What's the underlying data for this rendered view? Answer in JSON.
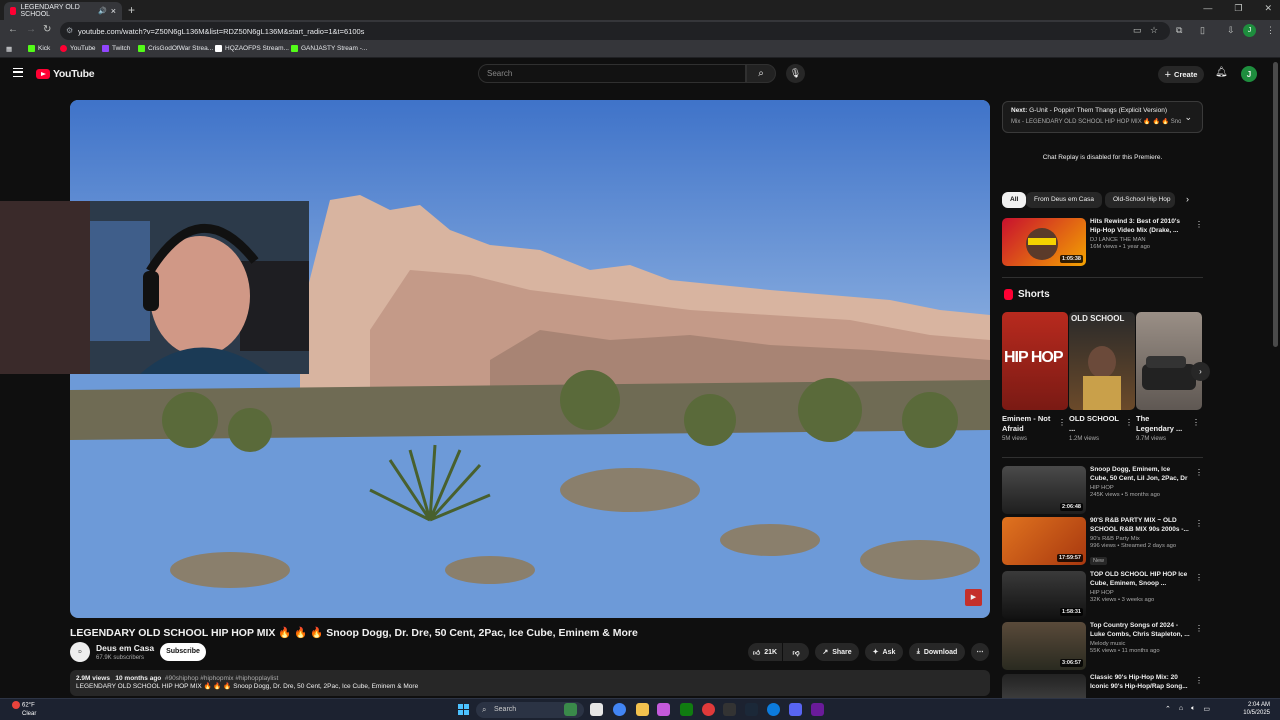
{
  "browser": {
    "tab_title": "LEGENDARY OLD SCHOOL",
    "tab_close": "×",
    "new_tab": "+",
    "url": "youtube.com/watch?v=Z50N6gL136M&list=RDZ50N6gL136M&start_radio=1&t=6100s",
    "bookmarks": [
      {
        "label": "Kick",
        "color": "#53fc18"
      },
      {
        "label": "YouTube",
        "color": "#ff0033"
      },
      {
        "label": "Twitch",
        "color": "#9146ff"
      },
      {
        "label": "CrisGodOfWar Strea...",
        "color": "#53fc18"
      },
      {
        "label": "HQZAOFPS Stream...",
        "color": "#ffffff"
      },
      {
        "label": "GANJASTY Stream -...",
        "color": "#53fc18"
      }
    ],
    "profile_initial": "J"
  },
  "youtube": {
    "logo_text": "YouTube",
    "search_placeholder": "Search",
    "create_label": "Create",
    "avatar_initial": "J"
  },
  "video": {
    "title": "LEGENDARY OLD SCHOOL HIP HOP MIX 🔥 🔥 🔥 Snoop Dogg, Dr. Dre, 50 Cent, 2Pac, Ice Cube, Eminem & More",
    "channel_name": "Deus em Casa",
    "channel_avatar_text": "D",
    "subscribers": "67.9K subscribers",
    "subscribe_label": "Subscribe",
    "likes": "21K",
    "share_label": "Share",
    "ask_label": "Ask",
    "download_label": "Download",
    "views": "2.9M views",
    "age": "10 months ago",
    "hashtags": "#90shiphop #hiphopmix #hiphopplaylist",
    "desc_line": "LEGENDARY OLD SCHOOL HIP HOP MIX 🔥 🔥 🔥 Snoop Dogg, Dr. Dre, 50 Cent, 2Pac, Ice Cube, Eminem & More"
  },
  "sidebar": {
    "next_label": "Next:",
    "next_title": "G-Unit - Poppin' Them Thangs (Explicit Version)",
    "next_mix": "Mix - LEGENDARY OLD SCHOOL HIP HOP MIX 🔥 🔥 🔥 Sno...",
    "chat_replay": "Chat Replay is disabled for this Premiere.",
    "chips": [
      "All",
      "From Deus em Casa",
      "Old-School Hip Hop"
    ],
    "top_rec": {
      "title": "Hits Rewind 3: Best of 2010's Hip-Hop Video Mix (Drake, ...",
      "channel": "DJ LANCE THE MAN",
      "meta": "16M views • 1 year ago",
      "duration": "1:05:38"
    },
    "shorts_title": "Shorts",
    "shorts": [
      {
        "title": "Eminem - Not Afraid",
        "views": "5M views",
        "thumb_text": "HIP HOP"
      },
      {
        "title": "OLD SCHOOL ...",
        "views": "1.2M views",
        "thumb_text": "OLD SCHOOL"
      },
      {
        "title": "The Legendary ...",
        "views": "9.7M views",
        "thumb_text": ""
      }
    ],
    "recs": [
      {
        "title": "Snoop Dogg, Eminem, Ice Cube, 50 Cent, Lil Jon, 2Pac, Dr Dre, ...",
        "channel": "HIP HOP",
        "meta": "245K views • 5 months ago",
        "duration": "2:06:48",
        "badge": ""
      },
      {
        "title": "90'S R&B PARTY MIX ~ OLD SCHOOL R&B MIX 90s 2000s -...",
        "channel": "90's R&B Party Mix",
        "meta": "996 views • Streamed 2 days ago",
        "duration": "17:59:57",
        "badge": "New"
      },
      {
        "title": "TOP OLD SCHOOL HIP HOP Ice Cube, Eminem, Snoop ...",
        "channel": "HIP HOP",
        "meta": "32K views • 3 weeks ago",
        "duration": "1:58:31",
        "badge": ""
      },
      {
        "title": "Top Country Songs of 2024 - Luke Combs, Chris Stapleton, ...",
        "channel": "Melody music",
        "meta": "55K views • 11 months ago",
        "duration": "3:06:57",
        "badge": ""
      },
      {
        "title": "Classic 90's Hip-Hop Mix: 20 Iconic 90's Hip-Hop/Rap Song...",
        "channel": "",
        "meta": "",
        "duration": "",
        "badge": ""
      }
    ]
  },
  "taskbar": {
    "weather_temp": "62°F",
    "weather_desc": "Clear",
    "weather_badge": "5",
    "search_label": "Search",
    "time": "2:04 AM",
    "date": "10/5/2025"
  }
}
